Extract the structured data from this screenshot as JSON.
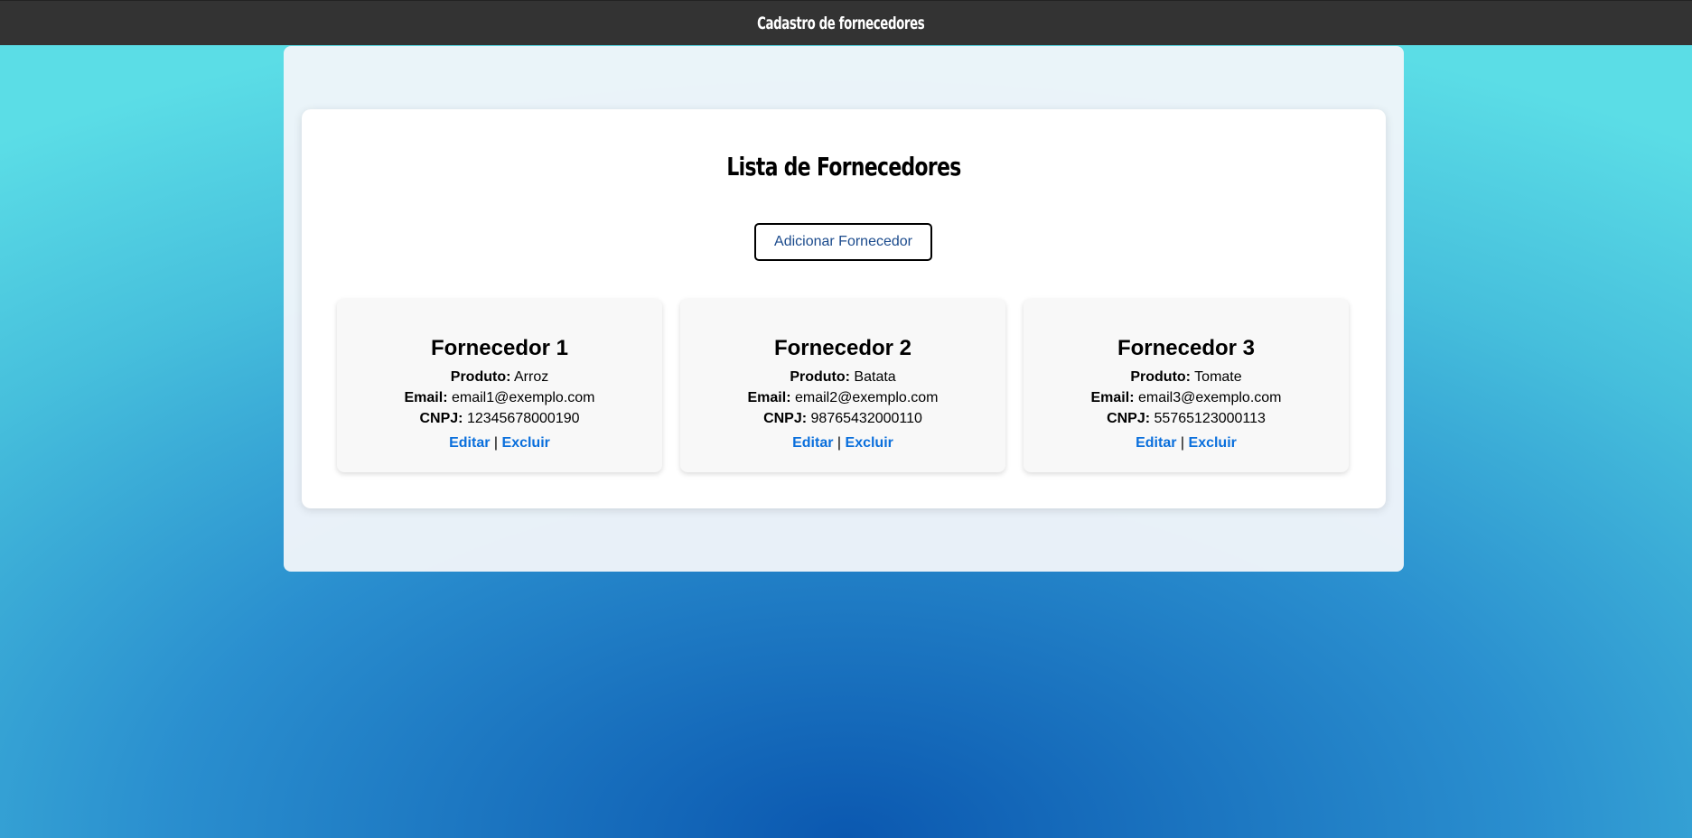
{
  "header": {
    "title": "Cadastro de fornecedores"
  },
  "main": {
    "title": "Lista de Fornecedores",
    "add_button_label": "Adicionar Fornecedor"
  },
  "labels": {
    "produto": "Produto:",
    "email": "Email:",
    "cnpj": "CNPJ:",
    "separator": "|"
  },
  "suppliers": [
    {
      "name": "Fornecedor 1",
      "produto": "Arroz",
      "email": "email1@exemplo.com",
      "cnpj": "12345678000190",
      "edit_label": "Editar",
      "delete_label": "Excluir"
    },
    {
      "name": "Fornecedor 2",
      "produto": "Batata",
      "email": "email2@exemplo.com",
      "cnpj": "98765432000110",
      "edit_label": "Editar",
      "delete_label": "Excluir"
    },
    {
      "name": "Fornecedor 3",
      "produto": "Tomate",
      "email": "email3@exemplo.com",
      "cnpj": "55765123000113",
      "edit_label": "Editar",
      "delete_label": "Excluir"
    }
  ],
  "colors": {
    "topbar": "#333333",
    "link": "#0a6fdc",
    "button_text": "#1a4a8c",
    "background_center": "#0b58b0",
    "background_edge": "#5bdde6"
  }
}
